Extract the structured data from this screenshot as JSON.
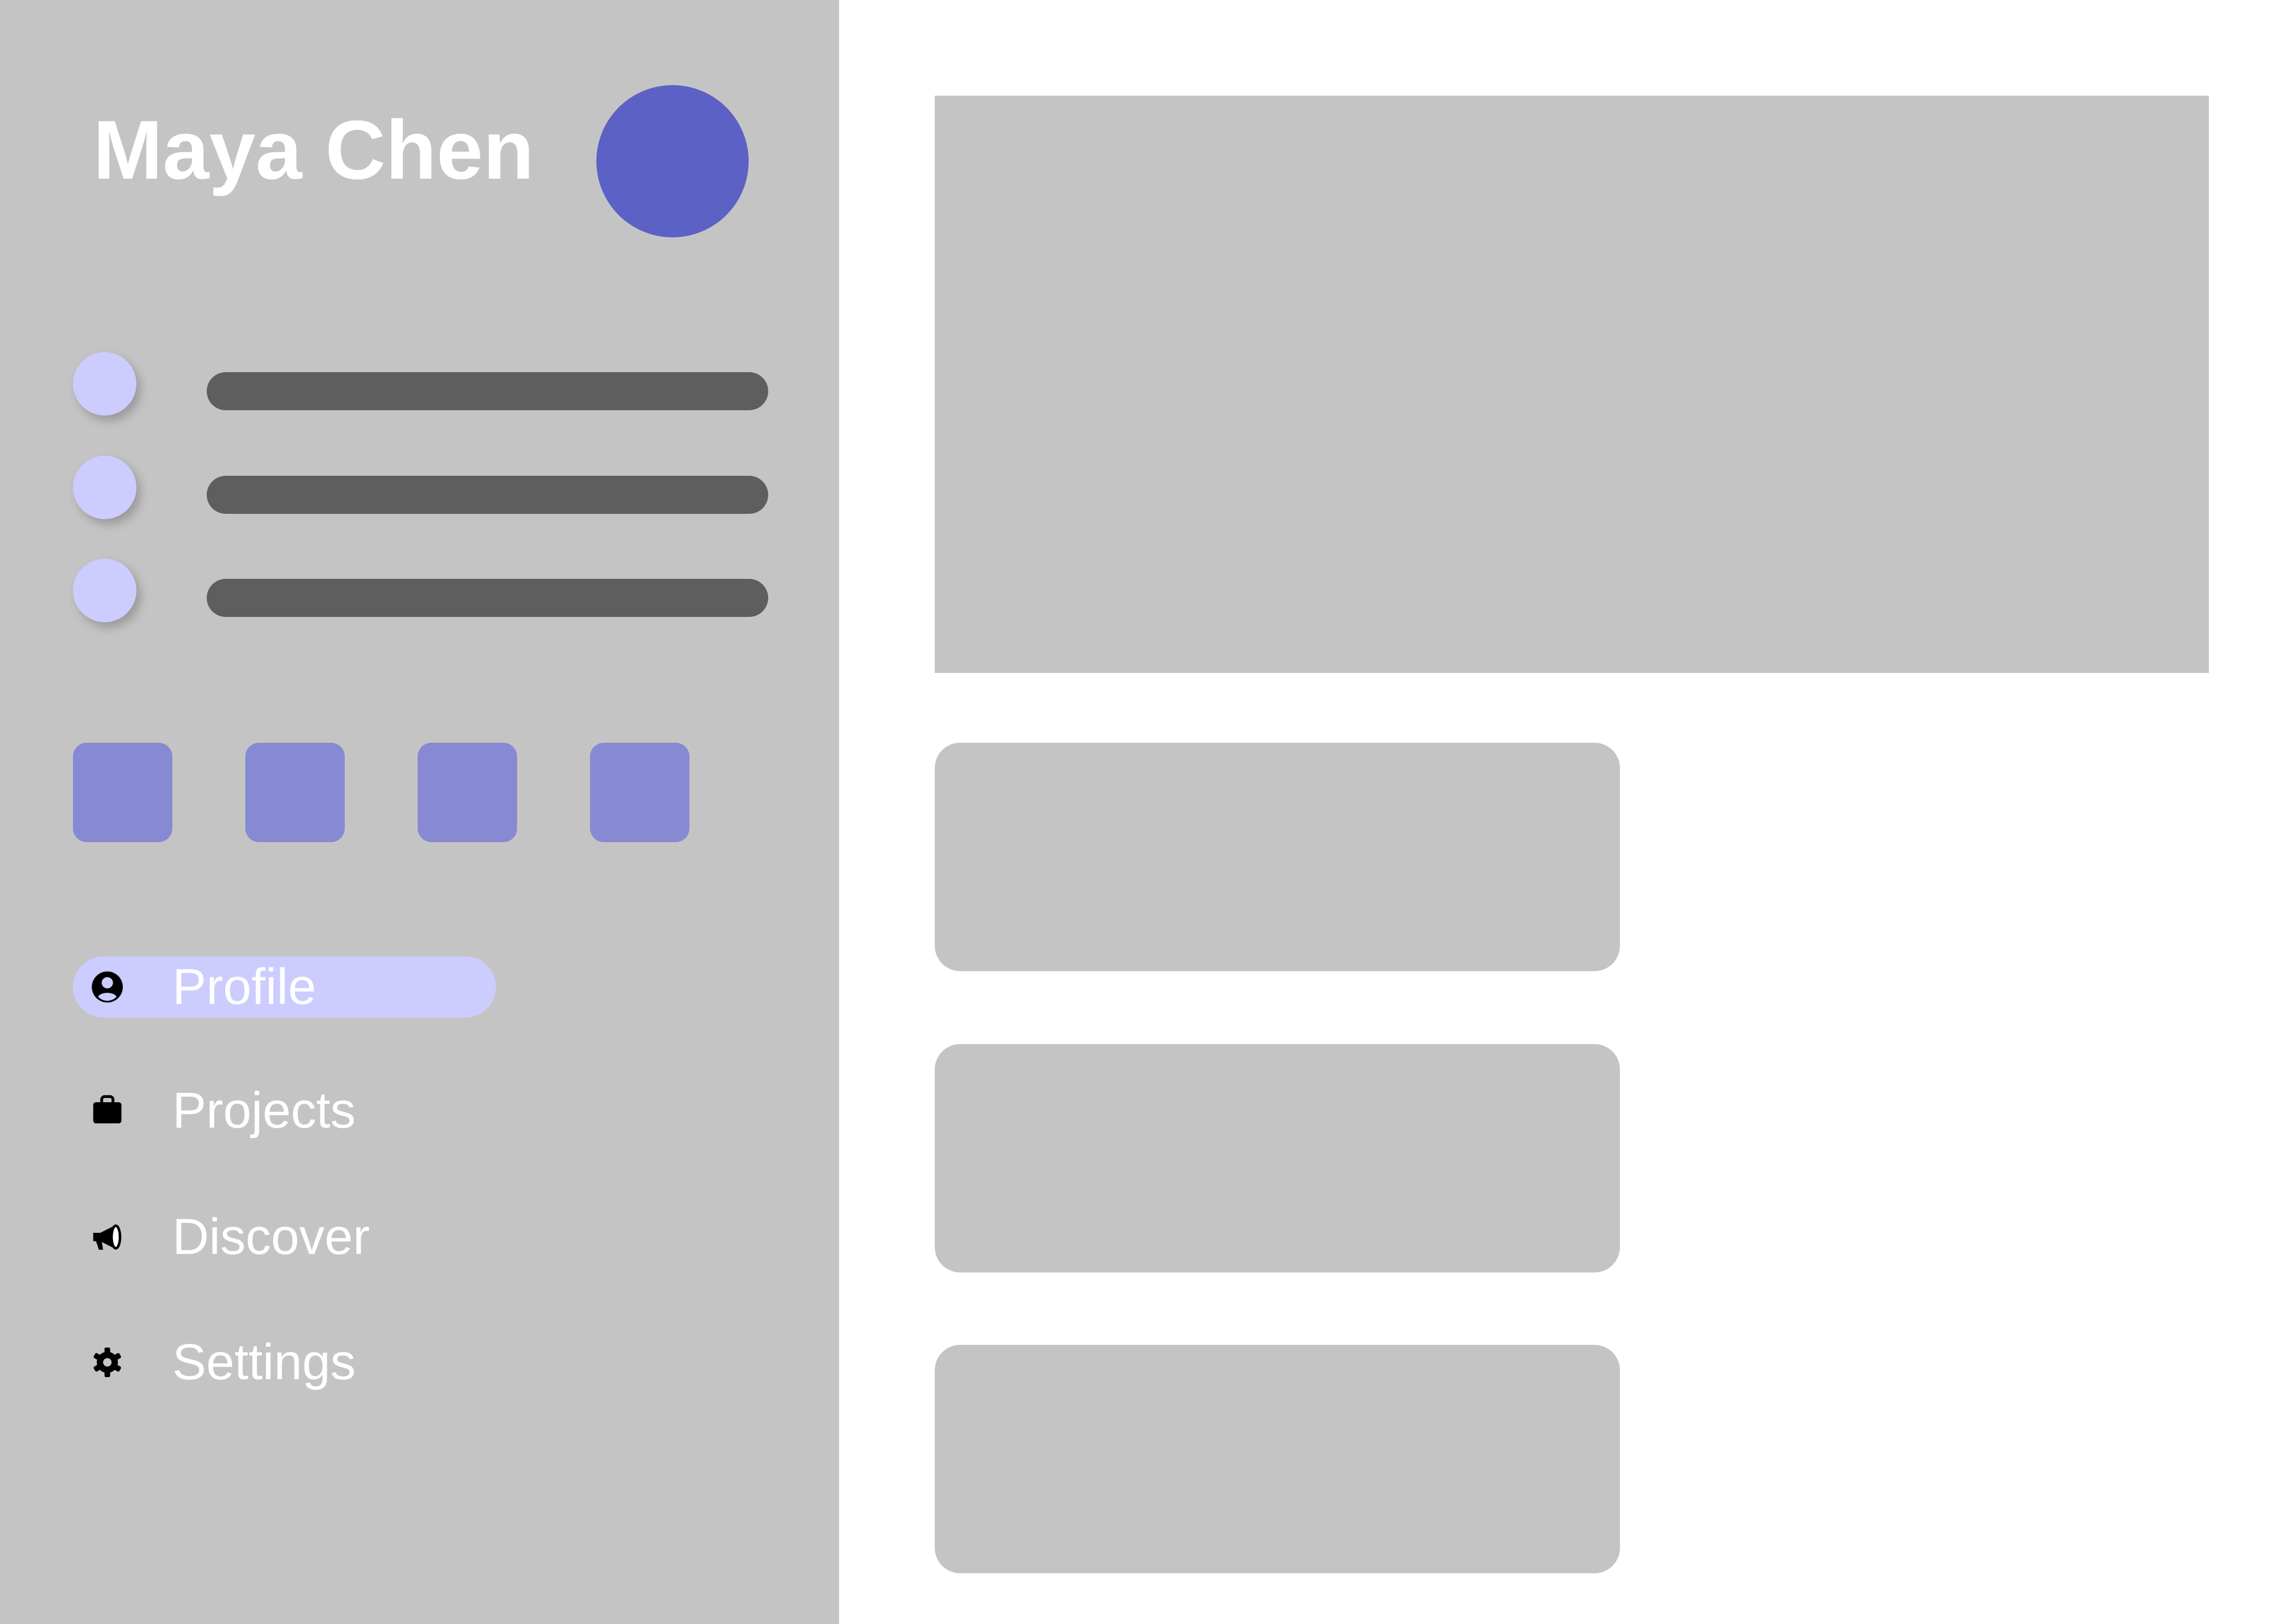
{
  "profile": {
    "name": "Maya Chen"
  },
  "colors": {
    "sidebar_bg": "#c4c4c4",
    "avatar": "#5c61c6",
    "skeleton_dot": "#ccccff",
    "skeleton_bar": "#5e5e5e",
    "tile": "#8789d3",
    "nav_active_pill": "#ccccff",
    "content_placeholder": "#c4c4c4"
  },
  "nav": {
    "items": [
      {
        "label": "Profile",
        "icon": "person-circle-icon",
        "active": true
      },
      {
        "label": "Projects",
        "icon": "briefcase-icon",
        "active": false
      },
      {
        "label": "Discover",
        "icon": "megaphone-icon",
        "active": false
      },
      {
        "label": "Settings",
        "icon": "gear-icon",
        "active": false
      }
    ]
  }
}
